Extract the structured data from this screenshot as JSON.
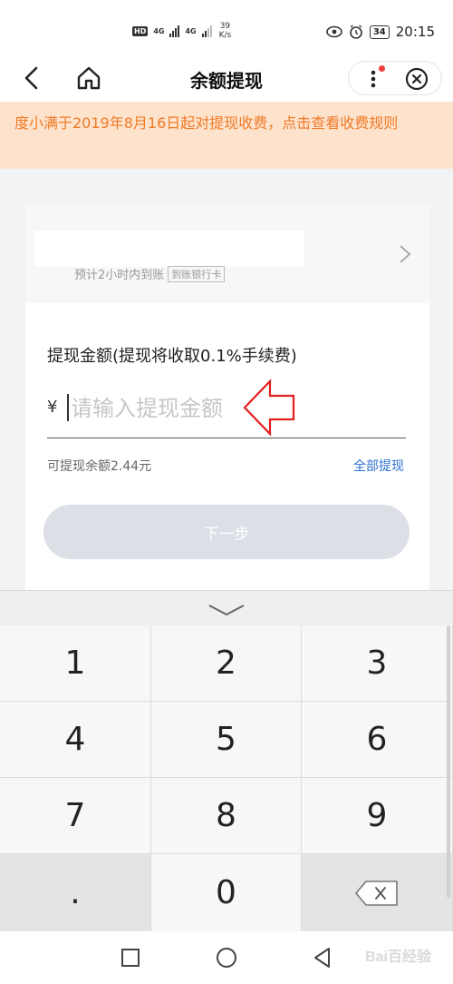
{
  "status_bar": {
    "network_1": "4G",
    "network_2": "4G",
    "speed_value": "39",
    "speed_unit": "K/s",
    "battery": "34",
    "time": "20:15"
  },
  "nav": {
    "title": "余额提现"
  },
  "notice": {
    "text": "度小满于2019年8月16日起对提现收费，点击查看收费规则"
  },
  "bank": {
    "eta": "预计2小时内到账",
    "tag": "到账银行卡"
  },
  "withdraw": {
    "label": "提现金额(提现将收取0.1%手续费)",
    "currency": "¥",
    "placeholder": "请输入提现金额",
    "balance_text": "可提现余额2.44元",
    "withdraw_all": "全部提现",
    "next_button": "下一步"
  },
  "keypad": {
    "keys": [
      "1",
      "2",
      "3",
      "4",
      "5",
      "6",
      "7",
      "8",
      "9",
      ".",
      "0"
    ]
  },
  "watermark": "Bai百经验",
  "colors": {
    "notice_bg": "#fde3cc",
    "notice_text": "#f07a28",
    "link": "#2d6fd0",
    "button_disabled": "#dcdfe5",
    "annotation_arrow": "#e02020"
  }
}
